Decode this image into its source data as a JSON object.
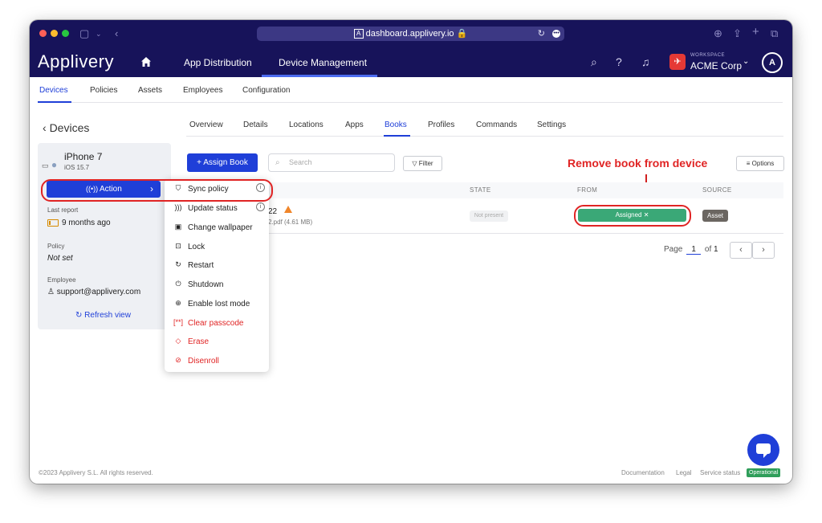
{
  "browser": {
    "url": "dashboard.applivery.io"
  },
  "app": {
    "logo": "Applivery",
    "nav": [
      "App Distribution",
      "Device Management"
    ],
    "workspace_label": "WORKSPACE",
    "workspace_name": "ACME Corp"
  },
  "subnav": [
    "Devices",
    "Policies",
    "Assets",
    "Employees",
    "Configuration"
  ],
  "page": {
    "back_label": "Devices"
  },
  "tabs": [
    "Overview",
    "Details",
    "Locations",
    "Apps",
    "Books",
    "Profiles",
    "Commands",
    "Settings"
  ],
  "device": {
    "name": "iPhone 7",
    "os": "iOS 15.7",
    "action_label": "Action",
    "last_report_label": "Last report",
    "last_report_value": "9 months ago",
    "policy_label": "Policy",
    "policy_value": "Not set",
    "employee_label": "Employee",
    "employee_value": "support@applivery.com",
    "refresh_label": "Refresh view"
  },
  "toolbar": {
    "assign_label": "+ Assign Book",
    "search_placeholder": "Search",
    "filter_label": "Filter",
    "options_label": "Options"
  },
  "annotation": "Remove book from device",
  "table": {
    "headers": [
      "STATE",
      "FROM",
      "SOURCE"
    ],
    "row": {
      "title_fragment": "22",
      "file_fragment": "2.pdf (4.61 MB)",
      "state": "Not present",
      "from": "Assigned ✕",
      "source": "Asset"
    }
  },
  "pager": {
    "page_label": "Page",
    "current": "1",
    "of_label": "of",
    "total": "1"
  },
  "menu": {
    "items": [
      {
        "label": "Sync policy",
        "icon": "shield-icon",
        "danger": false,
        "info": true
      },
      {
        "label": "Update status",
        "icon": "signal-icon",
        "danger": false,
        "info": true
      },
      {
        "label": "Change wallpaper",
        "icon": "image-icon",
        "danger": false,
        "info": false
      },
      {
        "label": "Lock",
        "icon": "lock-icon",
        "danger": false,
        "info": false
      },
      {
        "label": "Restart",
        "icon": "restart-icon",
        "danger": false,
        "info": false
      },
      {
        "label": "Shutdown",
        "icon": "power-icon",
        "danger": false,
        "info": false
      },
      {
        "label": "Enable lost mode",
        "icon": "lost-mode-icon",
        "danger": false,
        "info": false
      },
      {
        "label": "Clear passcode",
        "icon": "passcode-icon",
        "danger": true,
        "info": false
      },
      {
        "label": "Erase",
        "icon": "eraser-icon",
        "danger": true,
        "info": false
      },
      {
        "label": "Disenroll",
        "icon": "unlink-icon",
        "danger": true,
        "info": false
      }
    ]
  },
  "footer": {
    "copyright": "©2023 Applivery S.L. All rights reserved.",
    "links": [
      "Documentation",
      "Legal",
      "Service status"
    ],
    "status_badge": "Operational"
  },
  "colors": {
    "brand": "#17135a",
    "accent": "#1f3fd8",
    "danger": "#e02424",
    "success": "#3aa877"
  }
}
